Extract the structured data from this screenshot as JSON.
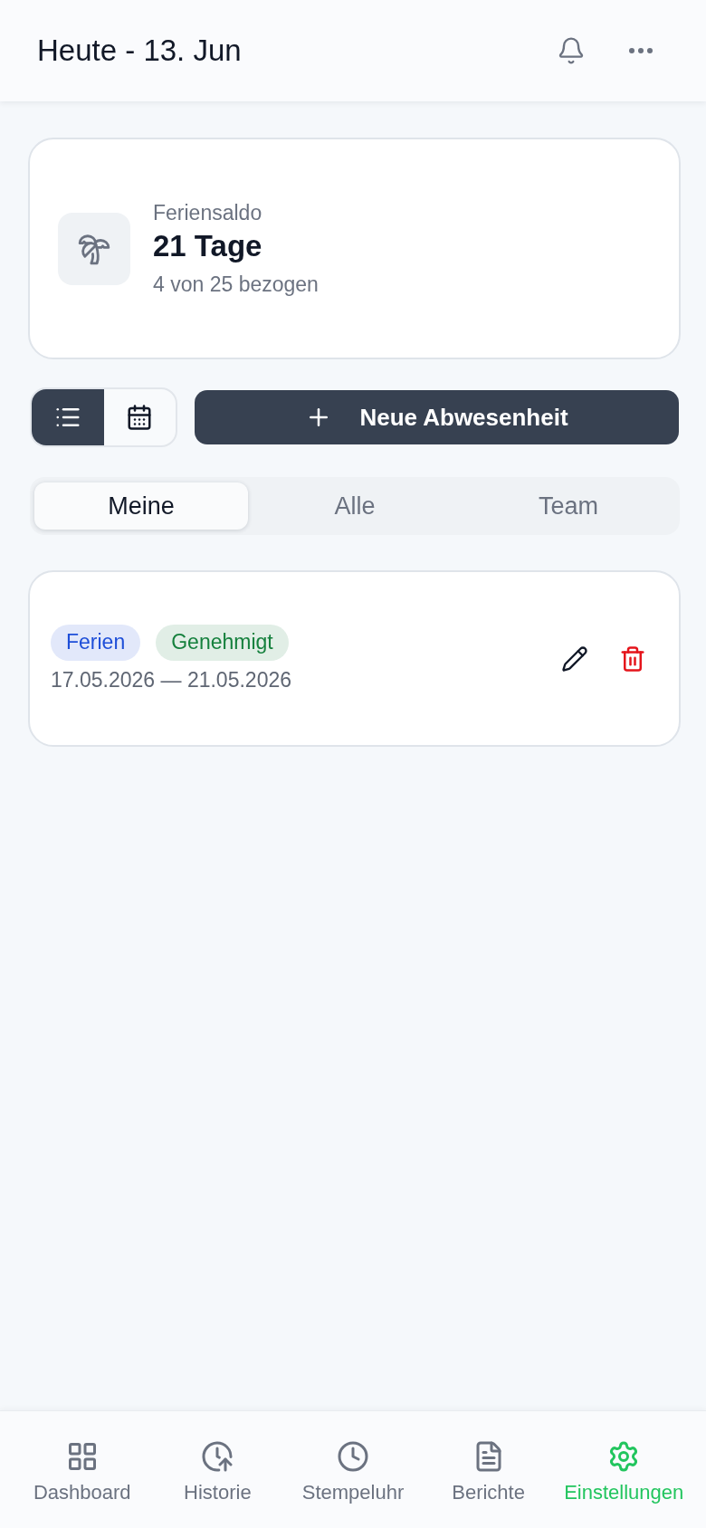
{
  "header": {
    "title": "Heute - 13. Jun"
  },
  "balance_card": {
    "label": "Feriensaldo",
    "value": "21 Tage",
    "detail": "4 von 25 bezogen"
  },
  "view_toggle": [
    {
      "selected": true
    },
    {
      "selected": false
    }
  ],
  "new_button": {
    "label": "Neue Abwesenheit"
  },
  "tabs": [
    {
      "label": "Meine",
      "selected": true
    },
    {
      "label": "Alle",
      "selected": false
    },
    {
      "label": "Team",
      "selected": false
    }
  ],
  "absences": [
    {
      "badges": [
        {
          "label": "Ferien",
          "color": "#1d4ed8"
        },
        {
          "label": "Genehmigt",
          "color": "#15803d"
        }
      ],
      "date_range": "17.05.2026 — 21.05.2026"
    }
  ],
  "bottom_nav": [
    {
      "label": "Dashboard",
      "selected": false
    },
    {
      "label": "Historie",
      "selected": false
    },
    {
      "label": "Stempeluhr",
      "selected": false
    },
    {
      "label": "Berichte",
      "selected": false
    },
    {
      "label": "Einstellungen",
      "selected": true
    }
  ]
}
